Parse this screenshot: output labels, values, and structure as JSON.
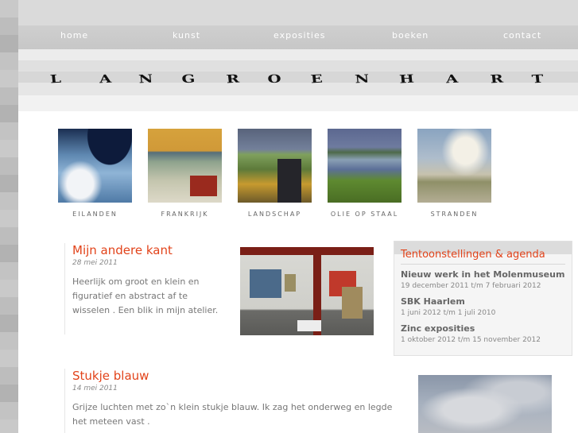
{
  "nav": [
    "home",
    "kunst",
    "exposities",
    "boeken",
    "contact"
  ],
  "logo": {
    "text": "LANGROENHART",
    "letters": [
      "L",
      "A",
      "N",
      "G",
      "R",
      "O",
      "E",
      "N",
      "H",
      "A",
      "R",
      "T"
    ]
  },
  "gallery": [
    {
      "label": "EILANDEN"
    },
    {
      "label": "FRANKRIJK"
    },
    {
      "label": "LANDSCHAP"
    },
    {
      "label": "OLIE OP STAAL"
    },
    {
      "label": "STRANDEN"
    }
  ],
  "posts": [
    {
      "title": "Mijn andere kant",
      "date": "28 mei 2011",
      "text": "Heerlijk om groot en klein en figuratief en abstract af te wisselen . Een blik in mijn atelier."
    },
    {
      "title": "Stukje blauw",
      "date": "14 mei 2011",
      "text": "Grijze luchten met zo`n klein stukje blauw. Ik zag het onderweg en legde het meteen vast ."
    }
  ],
  "sidebar": {
    "title": "Tentoonstellingen & agenda",
    "items": [
      {
        "title": "Nieuw werk in het Molenmuseum",
        "date": "19 december 2011 t/m 7 februari 2012"
      },
      {
        "title": "SBK Haarlem",
        "date": "1 juni 2012 t/m 1 juli 2010"
      },
      {
        "title": "Zinc exposities",
        "date": "1 oktober 2012 t/m 15 november 2012"
      }
    ]
  },
  "colors": {
    "accent": "#e2431a",
    "text": "#777777",
    "nav_text": "#ffffff"
  }
}
